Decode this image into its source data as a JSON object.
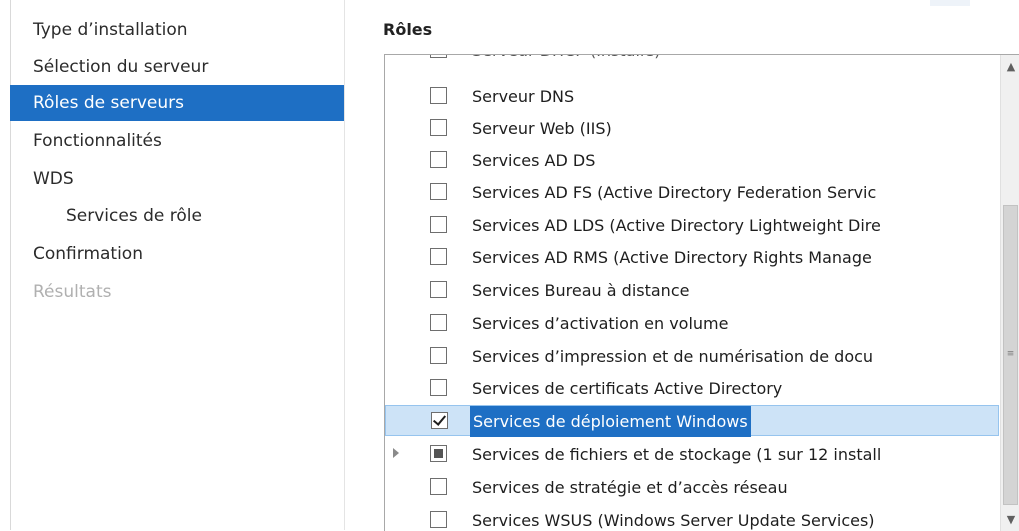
{
  "nav": {
    "items": [
      {
        "label": "Type d’installation",
        "state": "normal"
      },
      {
        "label": "Sélection du serveur",
        "state": "normal"
      },
      {
        "label": "Rôles de serveurs",
        "state": "selected"
      },
      {
        "label": "Fonctionnalités",
        "state": "normal"
      },
      {
        "label": "WDS",
        "state": "normal"
      },
      {
        "label": "Services de rôle",
        "state": "sub"
      },
      {
        "label": "Confirmation",
        "state": "normal"
      },
      {
        "label": "Résultats",
        "state": "disabled"
      }
    ]
  },
  "roles": {
    "title": "Rôles",
    "partial_top_label": "Serveur DHCP (Installé)",
    "items": [
      {
        "label": "Serveur DNS",
        "checked": false
      },
      {
        "label": "Serveur Web (IIS)",
        "checked": false
      },
      {
        "label": "Services AD DS",
        "checked": false
      },
      {
        "label": "Services AD FS (Active Directory Federation Servic",
        "checked": false
      },
      {
        "label": "Services AD LDS (Active Directory Lightweight Dire",
        "checked": false
      },
      {
        "label": "Services AD RMS (Active Directory Rights Manage",
        "checked": false
      },
      {
        "label": "Services Bureau à distance",
        "checked": false
      },
      {
        "label": "Services d’activation en volume",
        "checked": false
      },
      {
        "label": "Services d’impression et de numérisation de docu",
        "checked": false
      },
      {
        "label": "Services de certificats Active Directory",
        "checked": false
      },
      {
        "label": "Services de déploiement Windows",
        "checked": true,
        "selected": true
      },
      {
        "label": "Services de fichiers et de stockage (1 sur 12 install",
        "checked": "partial",
        "expandable": true
      },
      {
        "label": "Services de stratégie et d’accès réseau",
        "checked": false
      },
      {
        "label": "Services WSUS (Windows Server Update Services)",
        "checked": false
      }
    ]
  },
  "colors": {
    "accent": "#1e6fc4",
    "selection_row": "#cde3f7"
  }
}
